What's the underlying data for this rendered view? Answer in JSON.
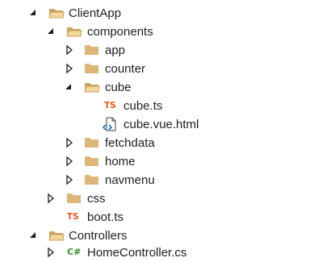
{
  "tree": {
    "nodes": [
      {
        "label": "ClientApp",
        "type": "folder",
        "state": "expanded"
      },
      {
        "label": "components",
        "type": "folder",
        "state": "expanded"
      },
      {
        "label": "app",
        "type": "folder",
        "state": "collapsed"
      },
      {
        "label": "counter",
        "type": "folder",
        "state": "collapsed"
      },
      {
        "label": "cube",
        "type": "folder",
        "state": "expanded"
      },
      {
        "label": "cube.ts",
        "type": "typescript-file",
        "badge": "TS"
      },
      {
        "label": "cube.vue.html",
        "type": "html-file"
      },
      {
        "label": "fetchdata",
        "type": "folder",
        "state": "collapsed"
      },
      {
        "label": "home",
        "type": "folder",
        "state": "collapsed"
      },
      {
        "label": "navmenu",
        "type": "folder",
        "state": "collapsed"
      },
      {
        "label": "css",
        "type": "folder",
        "state": "collapsed"
      },
      {
        "label": "boot.ts",
        "type": "typescript-file",
        "badge": "TS"
      },
      {
        "label": "Controllers",
        "type": "folder",
        "state": "expanded"
      },
      {
        "label": "HomeController.cs",
        "type": "csharp-file",
        "badge": "C#",
        "state": "collapsed"
      }
    ]
  },
  "colors": {
    "folder": "#dcb67a",
    "folder_dark": "#c9a262",
    "ts_badge": "#e8541f",
    "cs_badge": "#3a8a2e",
    "expander": "#1e1e1e",
    "text": "#1e1e1e",
    "html_file_accent": "#1e73be"
  }
}
